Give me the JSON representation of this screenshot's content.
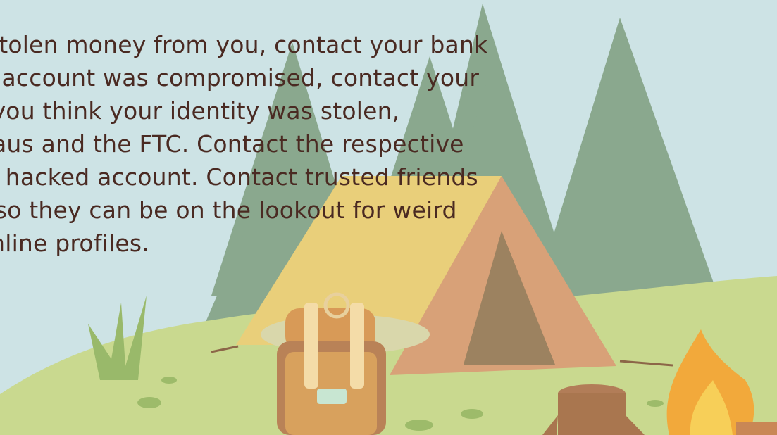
{
  "slide": {
    "body_lines": [
      "e has stolen money from you, contact your bank",
      "a work account was compromised, contact your",
      "ent. If you think your identity was stolen,",
      "it bureaus and the FTC. Contact the respective",
      "ing the hacked account. Contact trusted friends",
      "natter so they can be on the lookout for weird",
      "your online profiles."
    ],
    "colors": {
      "background": "#cde3e5",
      "text": "#4a2a22",
      "trees": "#8aa88e",
      "ground": "#c9d98f",
      "tent_yellow": "#e9cf7a",
      "tent_orange": "#d8a178",
      "fire": "#f2a93b"
    },
    "icons": [
      "pine-tree-icon",
      "tent-icon",
      "backpack-icon",
      "tree-stump-icon",
      "campfire-icon",
      "grass-icon"
    ]
  }
}
